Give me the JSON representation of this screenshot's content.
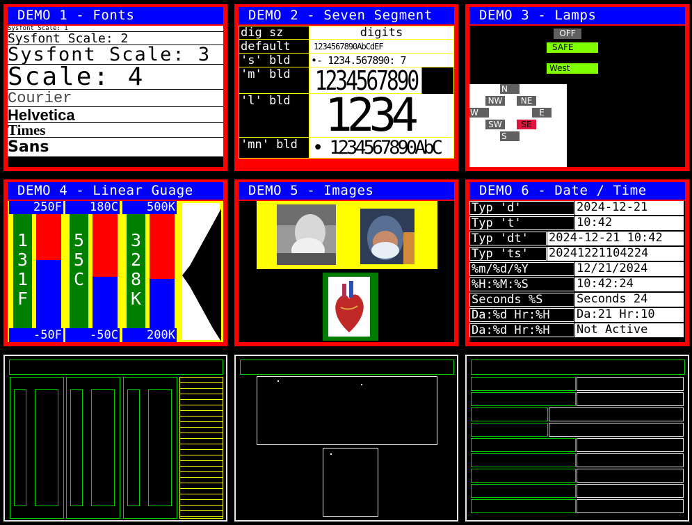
{
  "demo1": {
    "title": "DEMO 1 - Fonts",
    "rows": [
      "Sysfont Scale: 1",
      "Sysfont Scale: 2",
      "Sysfont Scale: 3",
      "Scale: 4",
      "Courier",
      "Helvetica",
      "Times",
      "Sans"
    ]
  },
  "demo2": {
    "title": "DEMO 2 - Seven Segment",
    "header_label": "dig sz",
    "header_value": "digits",
    "rows": [
      {
        "label": "default",
        "digits": "1234567890AbCdEF"
      },
      {
        "label": "'s' bld",
        "digits": "•- 1234.567890: 7"
      },
      {
        "label": "'m' bld",
        "digits": "1234567890"
      },
      {
        "label": "'l' bld",
        "digits": "1234"
      },
      {
        "label": "'mn' bld",
        "digits": "• 1234567890AbC"
      }
    ]
  },
  "demo3": {
    "title": "DEMO 3 - Lamps",
    "lamps": [
      "OFF",
      "SAFE",
      "West"
    ],
    "compass": [
      "N",
      "NW",
      "NE",
      "W",
      "E",
      "SW",
      "SE",
      "S"
    ],
    "colors": {
      "off": "#606060",
      "safe": "#80ff00",
      "alert": "#e0143c"
    }
  },
  "demo4": {
    "title": "DEMO 4 - Linear Guage",
    "gauges": [
      {
        "top": "250F",
        "bottom": "-50F",
        "value": "131F",
        "fill": 0.6
      },
      {
        "top": "180C",
        "bottom": "-50C",
        "value": "55C",
        "fill": 0.45
      },
      {
        "top": "500K",
        "bottom": "200K",
        "value": "328K",
        "fill": 0.43
      }
    ]
  },
  "demo5": {
    "title": "DEMO 5 - Images"
  },
  "demo6": {
    "title": "DEMO 6 - Date / Time",
    "rows": [
      {
        "label": "Typ 'd'",
        "value": "2024-12-21"
      },
      {
        "label": "Typ 't'",
        "value": "10:42"
      },
      {
        "label": "Typ 'dt'",
        "value": "2024-12-21 10:42"
      },
      {
        "label": "Typ 'ts'",
        "value": "20241221104224"
      },
      {
        "label": "%m/%d/%Y",
        "value": "12/21/2024"
      },
      {
        "label": "%H:%M:%S",
        "value": "10:42:24"
      },
      {
        "label": "Seconds %S",
        "value": "Seconds 24"
      },
      {
        "label": "Da:%d Hr:%H",
        "value": "Da:21 Hr:10"
      },
      {
        "label": "Da:%d Hr:%H",
        "value": "Not Active"
      }
    ]
  }
}
